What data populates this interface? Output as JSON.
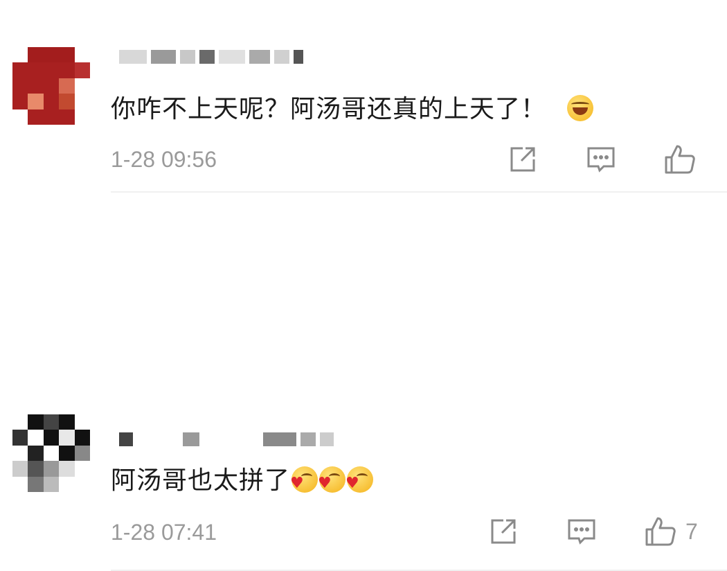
{
  "comments": [
    {
      "username": "",
      "text": "你咋不上天呢？阿汤哥还真的上天了！",
      "emojis": [
        "laughing-crying"
      ],
      "time": "1-28 09:56",
      "like_count": ""
    },
    {
      "username": "",
      "text": "阿汤哥也太拼了",
      "emojis": [
        "heart-kiss",
        "heart-kiss",
        "heart-kiss"
      ],
      "time": "1-28 07:41",
      "like_count": "7"
    }
  ],
  "icons": {
    "share": "share-icon",
    "comment": "comment-icon",
    "like": "thumbs-up-icon"
  },
  "colors": {
    "text": "#1a1a1a",
    "meta": "#9a9a9a",
    "icon": "#8a8a8a"
  }
}
